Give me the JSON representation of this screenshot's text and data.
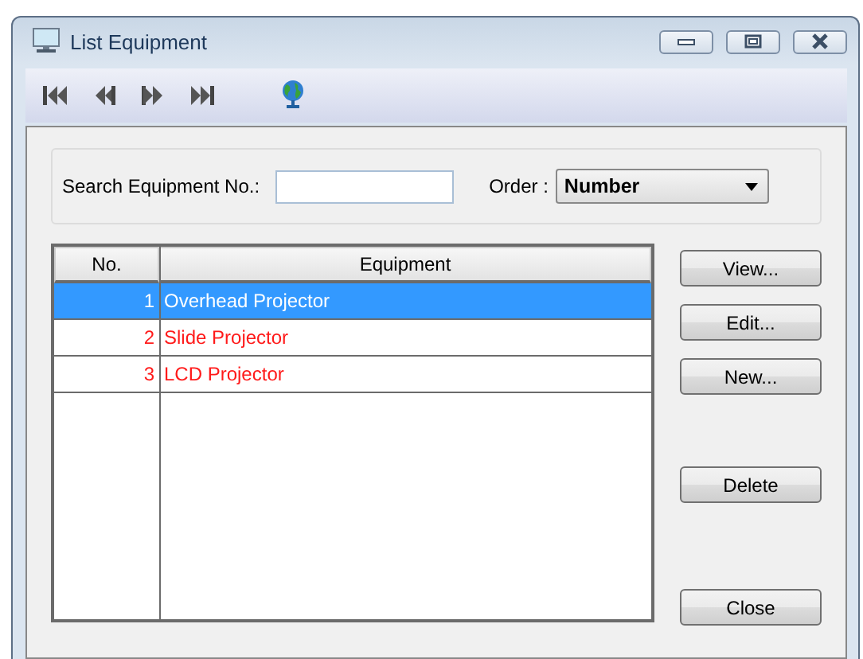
{
  "window": {
    "title": "List Equipment"
  },
  "search": {
    "label": "Search Equipment No.:"
  },
  "order": {
    "label": "Order :",
    "value": "Number"
  },
  "table": {
    "columns": [
      "No.",
      "Equipment"
    ],
    "rows": [
      {
        "cells": [
          "1",
          "Overhead Projector"
        ],
        "selected": true
      },
      {
        "cells": [
          "2",
          "Slide Projector"
        ],
        "selected": false
      },
      {
        "cells": [
          "3",
          "LCD Projector"
        ],
        "selected": false
      }
    ]
  },
  "buttons": [
    "View...",
    "Edit...",
    "New...",
    "Delete",
    "Close"
  ]
}
